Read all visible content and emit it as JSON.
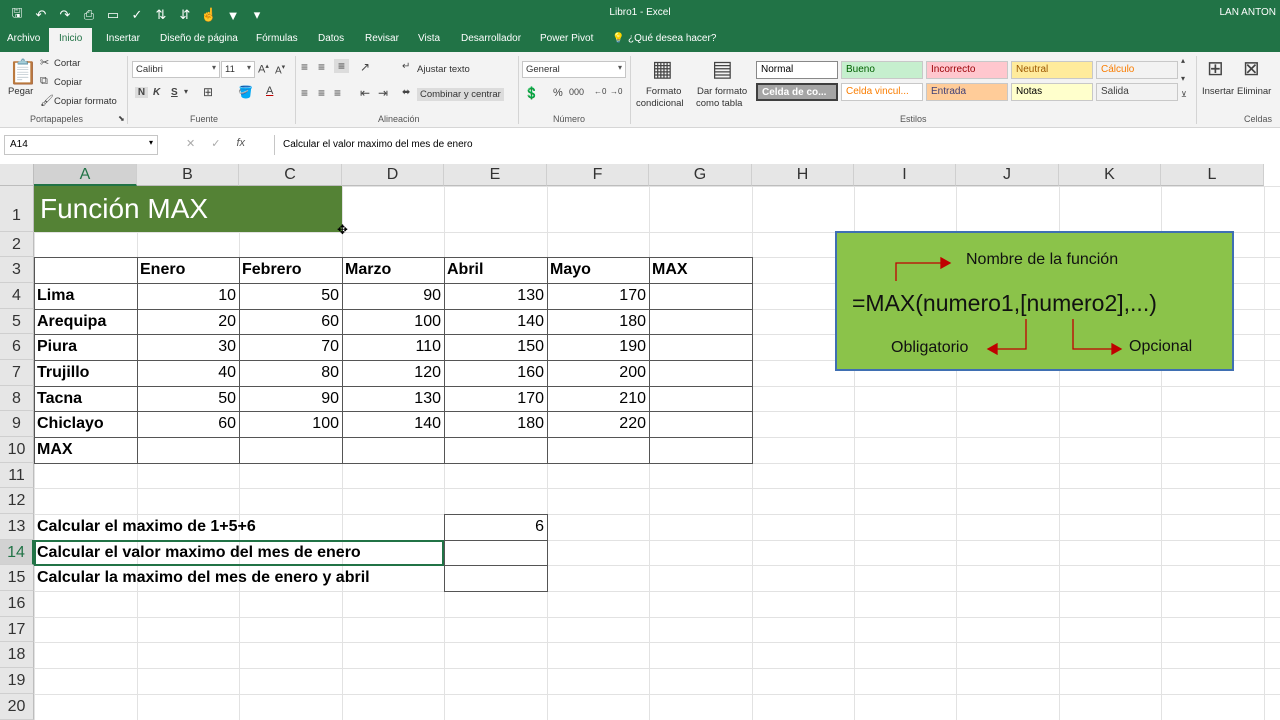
{
  "window": {
    "title": "Libro1  -  Excel",
    "user": "LAN ANTON",
    "quick_access": [
      {
        "icon": "save-icon",
        "glyph": "🖫"
      },
      {
        "icon": "undo-icon",
        "glyph": "↶"
      },
      {
        "icon": "redo-icon",
        "glyph": "↷"
      },
      {
        "icon": "print-preview-icon",
        "glyph": "⎙"
      },
      {
        "icon": "open-icon",
        "glyph": "▭"
      },
      {
        "icon": "spellcheck-icon",
        "glyph": "✓"
      },
      {
        "icon": "sort-asc-icon",
        "glyph": "⇅"
      },
      {
        "icon": "sort-desc-icon",
        "glyph": "⇵"
      },
      {
        "icon": "touch-mode-icon",
        "glyph": "☝"
      },
      {
        "icon": "filter-icon",
        "glyph": "▼"
      },
      {
        "icon": "customize-icon",
        "glyph": "▾"
      }
    ]
  },
  "tabs": [
    "Archivo",
    "Inicio",
    "Insertar",
    "Diseño de página",
    "Fórmulas",
    "Datos",
    "Revisar",
    "Vista",
    "Desarrollador",
    "Power Pivot",
    "¿Qué desea hacer?"
  ],
  "ribbon": {
    "paste": "Pegar",
    "cut": "Cortar",
    "copy": "Copiar",
    "format_painter": "Copiar formato",
    "font_name": "Calibri",
    "font_size": "11",
    "bold": "N",
    "italic": "K",
    "underline": "S",
    "wrap_text": "Ajustar texto",
    "merge_center": "Combinar y centrar",
    "number_format": "General",
    "conditional_format": [
      "Formato",
      "condicional"
    ],
    "format_table": [
      "Dar formato",
      "como tabla"
    ],
    "styles": [
      {
        "label": "Normal",
        "bg": "#ffffff",
        "fg": "#000000"
      },
      {
        "label": "Bueno",
        "bg": "#c6efce",
        "fg": "#006100"
      },
      {
        "label": "Incorrecto",
        "bg": "#ffc7ce",
        "fg": "#9c0006"
      },
      {
        "label": "Neutral",
        "bg": "#ffeb9c",
        "fg": "#9c5700"
      },
      {
        "label": "Cálculo",
        "bg": "#f2f2f2",
        "fg": "#fa7d00"
      },
      {
        "label": "Celda de co...",
        "bg": "#a5a5a5",
        "fg": "#ffffff"
      },
      {
        "label": "Celda vincul...",
        "bg": "#ffffff",
        "fg": "#fa7d00"
      },
      {
        "label": "Entrada",
        "bg": "#ffcc99",
        "fg": "#3f3f76"
      },
      {
        "label": "Notas",
        "bg": "#ffffcc",
        "fg": "#000000"
      },
      {
        "label": "Salida",
        "bg": "#f2f2f2",
        "fg": "#3f3f3f"
      }
    ],
    "insert": "Insertar",
    "delete": "Eliminar",
    "groups": [
      "Portapapeles",
      "Fuente",
      "Alineación",
      "Número",
      "Estilos",
      "Celdas"
    ]
  },
  "formula_bar": {
    "name_box": "A14",
    "fx": "fx",
    "content": "Calcular el valor maximo del mes de enero"
  },
  "sheet": {
    "columns": [
      "A",
      "B",
      "C",
      "D",
      "E",
      "F",
      "G",
      "H",
      "I",
      "J",
      "K",
      "L"
    ],
    "rows": [
      "1",
      "2",
      "3",
      "4",
      "5",
      "6",
      "7",
      "8",
      "9",
      "10",
      "11",
      "12",
      "13",
      "14",
      "15",
      "16",
      "17",
      "18",
      "19",
      "20"
    ],
    "title": "Función MAX",
    "title_bg": "#548235",
    "table_header": [
      "",
      "Enero",
      "Febrero",
      "Marzo",
      "Abril",
      "Mayo",
      "MAX"
    ],
    "table_rows": [
      {
        "city": "Lima",
        "values": [
          "10",
          "50",
          "90",
          "130",
          "170",
          ""
        ]
      },
      {
        "city": "Arequipa",
        "values": [
          "20",
          "60",
          "100",
          "140",
          "180",
          ""
        ]
      },
      {
        "city": "Piura",
        "values": [
          "30",
          "70",
          "110",
          "150",
          "190",
          ""
        ]
      },
      {
        "city": "Trujillo",
        "values": [
          "40",
          "80",
          "120",
          "160",
          "200",
          ""
        ]
      },
      {
        "city": "Tacna",
        "values": [
          "50",
          "90",
          "130",
          "170",
          "210",
          ""
        ]
      },
      {
        "city": "Chiclayo",
        "values": [
          "60",
          "100",
          "140",
          "180",
          "220",
          ""
        ]
      },
      {
        "city": "MAX",
        "values": [
          "",
          "",
          "",
          "",
          "",
          ""
        ]
      }
    ],
    "questions": [
      {
        "text": "Calcular el maximo de 1+5+6",
        "answer": "6"
      },
      {
        "text": "Calcular el valor maximo del mes de enero",
        "answer": ""
      },
      {
        "text": "Calcular la maximo del mes de enero y abril",
        "answer": ""
      }
    ],
    "selected_cell": "A14"
  },
  "callout": {
    "bg": "#8bc34a",
    "name_label": "Nombre de la función",
    "syntax": "=MAX(numero1,[numero2],...)",
    "required_label": "Obligatorio",
    "optional_label": "Opcional",
    "arrow_color": "#c00000"
  }
}
